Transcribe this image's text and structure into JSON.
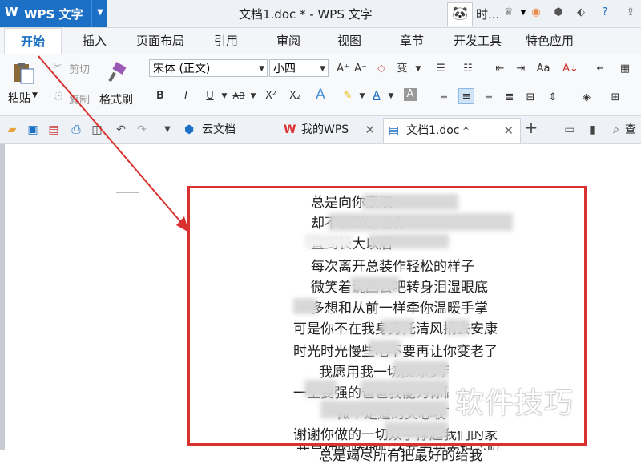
{
  "titlebar": {
    "app_logo": "W",
    "app_name": "WPS 文字",
    "doc_title": "文档1.doc * - WPS 文字",
    "user_name": "时..."
  },
  "menu": {
    "tabs": [
      "开始",
      "插入",
      "页面布局",
      "引用",
      "审阅",
      "视图",
      "章节",
      "开发工具",
      "特色应用"
    ],
    "active": "开始"
  },
  "ribbon": {
    "paste": "粘贴",
    "cut": "剪切",
    "copy": "复制",
    "format_painter": "格式刷",
    "font_name": "宋体 (正文)",
    "font_size": "小四"
  },
  "doc_tabs": {
    "cloud": "云文档",
    "mywps": "我的WPS",
    "current": "文档1.doc *",
    "search": "查"
  },
  "poem": {
    "lines": [
      "总是向你索取",
      "却不曾说谢谢你",
      "直到长大以后",
      "每次离开总装作轻松的样子",
      "微笑着说回去吧转身泪湿眼底",
      "多想和从前一样牵你温暖手掌",
      "可是你不在我身旁托清风捎去安康",
      "时光时光慢些吧不要再让你变老了",
      "我愿用我一切换你岁月长留",
      "一生要强的爸爸我能为你做些什么",
      "微不足道的关心收下吧",
      "谢谢你做的一切双手撑起我们的家",
      "总是竭尽所有把最好的给我"
    ],
    "partial_last_line": "我是你的骄傲吗还在为我而担心吗"
  },
  "watermark": "软件技巧"
}
